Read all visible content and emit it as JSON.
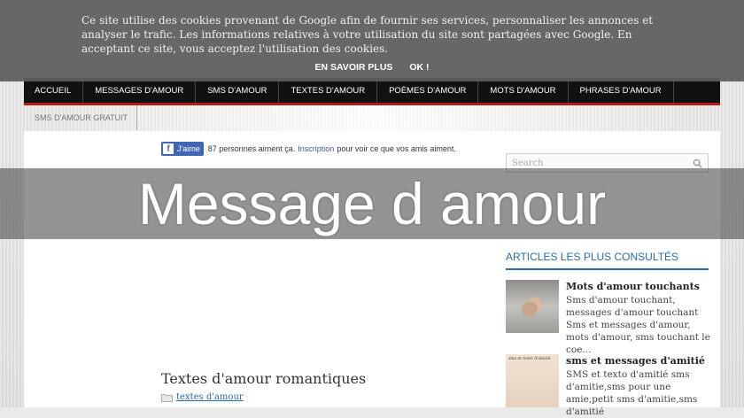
{
  "cookie": {
    "text": "Ce site utilise des cookies provenant de Google afin de fournir ses services, personnaliser les annonces et analyser le trafic. Les informations relatives à votre utilisation du site sont partagées avec Google. En acceptant ce site, vous acceptez l'utilisation des cookies.",
    "learn_more": "EN SAVOIR PLUS",
    "ok": "OK !"
  },
  "nav": {
    "items": [
      "ACCUEIL",
      "MESSAGES D'AMOUR",
      "SMS D'AMOUR",
      "TEXTES D'AMOUR",
      "POÈMES D'AMOUR",
      "MOTS D'AMOUR",
      "PHRASES D'AMOUR"
    ],
    "second_row": "SMS D'AMOUR GRATUIT"
  },
  "facebook": {
    "like": "J'aime",
    "count_text": "87 personnes aiment ça.",
    "signup": "Inscription",
    "rest": "pour voir ce que vos amis aiment."
  },
  "search": {
    "placeholder": "Search"
  },
  "sidebar": {
    "title": "ARTICLES LES PLUS CONSULTÉS",
    "articles": [
      {
        "title": "Mots d'amour touchants",
        "desc": "Sms d'amour touchant, messages d'amour touchant Sms et messages d'amour, mots d'amour, sms touchant le coe..."
      },
      {
        "title": "sms et messages d'amitié",
        "desc": "SMS et texto d'amitié sms d'amitie,sms pour une amie,petit sms d'amitie,sms d'amitié"
      }
    ],
    "thumb2_text": "sms et texte d'amitié"
  },
  "main": {
    "title": "Textes d'amour romantiques",
    "category": "textes d'amour"
  },
  "caption": "Message d amour"
}
